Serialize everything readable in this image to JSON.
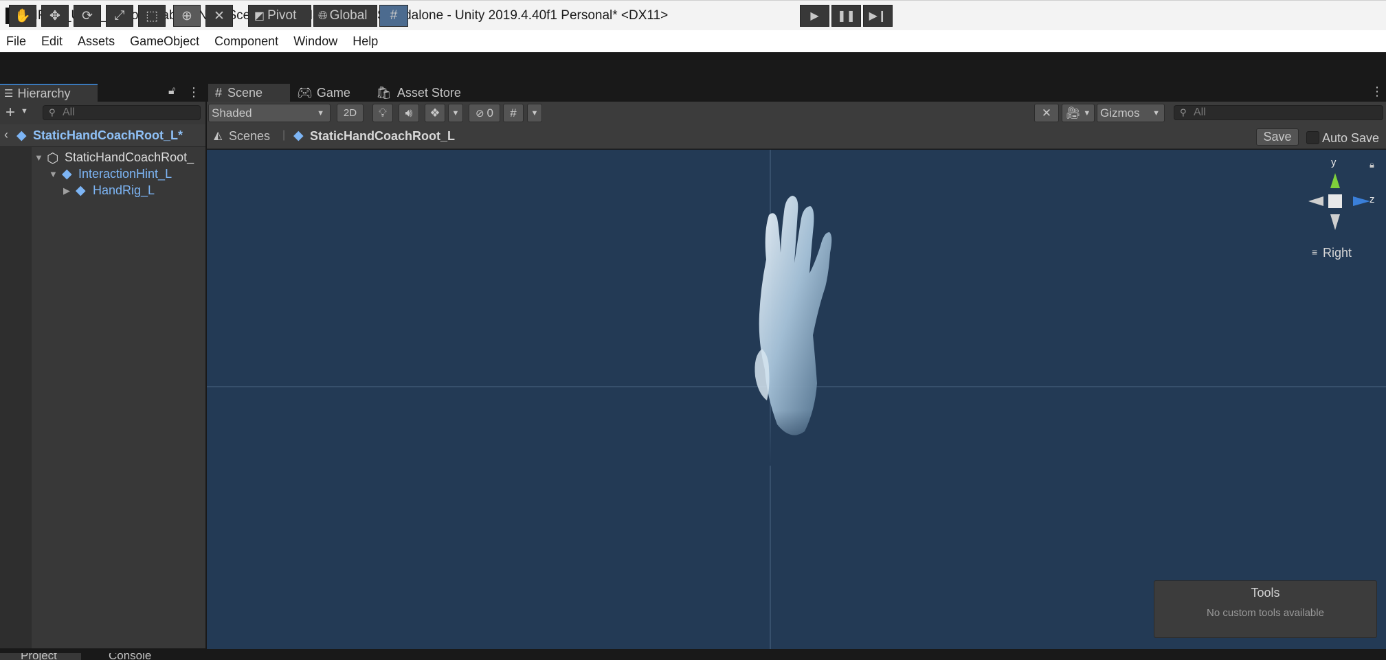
{
  "window": {
    "title": "MRDL_Unity_PeriodicTable - New Scene - PC, Mac & Linux Standalone - Unity 2019.4.40f1 Personal* <DX11>"
  },
  "menu": [
    "File",
    "Edit",
    "Assets",
    "GameObject",
    "Component",
    "Window",
    "Help"
  ],
  "toolbar": {
    "tools": [
      "hand-icon",
      "move-icon",
      "rotate-icon",
      "scale-icon",
      "rect-icon",
      "transform-icon",
      "custom-tool-icon"
    ],
    "pivot_label": "Pivot",
    "global_label": "Global",
    "play_icons": [
      "play-icon",
      "pause-icon",
      "step-icon"
    ]
  },
  "hierarchy": {
    "tab_label": "Hierarchy",
    "search_placeholder": "All",
    "prefab_root": "StaticHandCoachRoot_L*",
    "items": [
      {
        "label": "StaticHandCoachRoot_",
        "depth": 0,
        "expanded": true
      },
      {
        "label": "InteractionHint_L",
        "depth": 1,
        "expanded": true
      },
      {
        "label": "HandRig_L",
        "depth": 2,
        "expanded": false
      }
    ]
  },
  "scene": {
    "tabs": [
      "Scene",
      "Game",
      "Asset Store"
    ],
    "shading_mode": "Shaded",
    "mode_2d": "2D",
    "hidden_count": "0",
    "gizmos_label": "Gizmos",
    "search_placeholder": "All",
    "breadcrumb": {
      "scenes_label": "Scenes",
      "prefab_label": "StaticHandCoachRoot_L"
    },
    "save_label": "Save",
    "auto_save_label": "Auto Save",
    "axis": {
      "y_label": "y",
      "z_label": "z",
      "view_label": "Right"
    },
    "tools_overlay": {
      "title": "Tools",
      "message": "No custom tools available"
    }
  },
  "bottom_tabs": [
    "Project",
    "Console"
  ],
  "colors": {
    "accent": "#3a79bb",
    "prefab_blue": "#7db5f5",
    "viewport_bg": "#233a55"
  }
}
